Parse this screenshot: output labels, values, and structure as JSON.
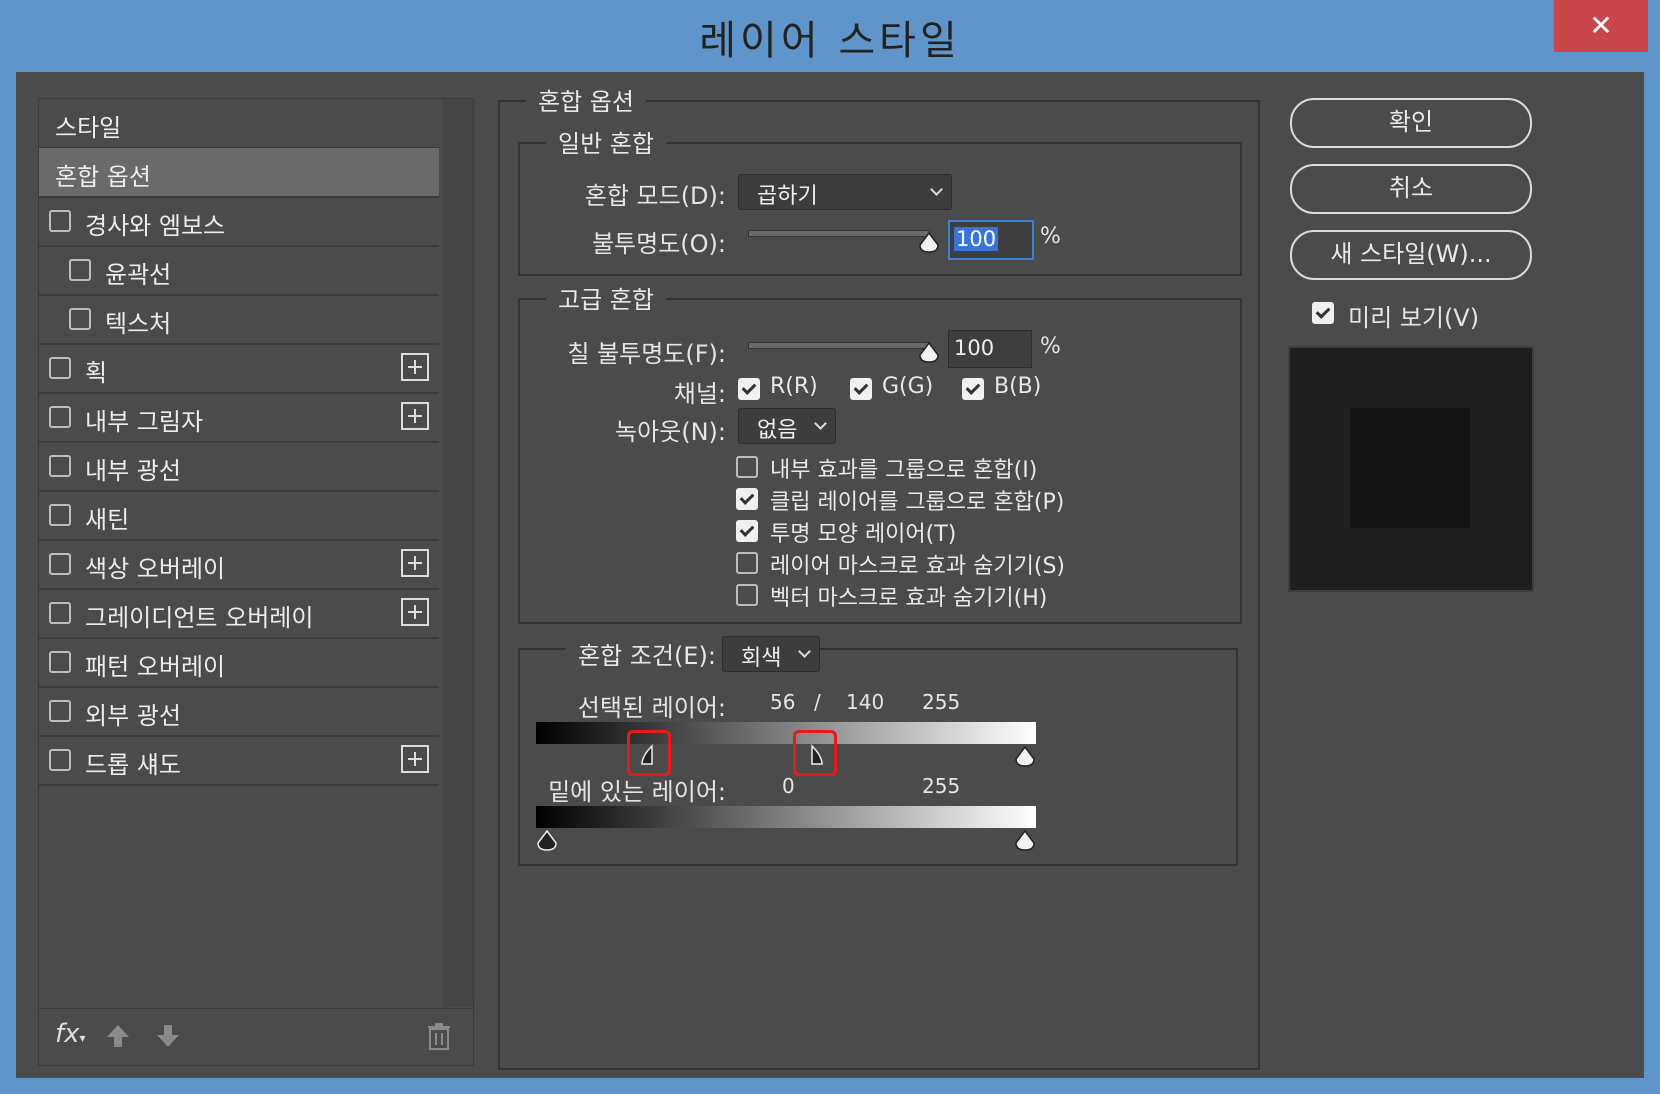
{
  "window": {
    "title": "레이어 스타일",
    "close_glyph": "✕"
  },
  "styles_panel": {
    "items": [
      {
        "label": "스타일",
        "checkbox": false,
        "checked": false,
        "plus": false,
        "selected": false
      },
      {
        "label": "혼합 옵션",
        "checkbox": false,
        "checked": false,
        "plus": false,
        "selected": true
      },
      {
        "label": "경사와 엠보스",
        "checkbox": true,
        "checked": false,
        "plus": false,
        "selected": false
      },
      {
        "label": "윤곽선",
        "checkbox": true,
        "checked": false,
        "plus": false,
        "selected": false
      },
      {
        "label": "텍스처",
        "checkbox": true,
        "checked": false,
        "plus": false,
        "selected": false
      },
      {
        "label": "획",
        "checkbox": true,
        "checked": false,
        "plus": true,
        "selected": false
      },
      {
        "label": "내부 그림자",
        "checkbox": true,
        "checked": false,
        "plus": true,
        "selected": false
      },
      {
        "label": "내부 광선",
        "checkbox": true,
        "checked": false,
        "plus": false,
        "selected": false
      },
      {
        "label": "새틴",
        "checkbox": true,
        "checked": false,
        "plus": false,
        "selected": false
      },
      {
        "label": "색상 오버레이",
        "checkbox": true,
        "checked": false,
        "plus": true,
        "selected": false
      },
      {
        "label": "그레이디언트 오버레이",
        "checkbox": true,
        "checked": false,
        "plus": true,
        "selected": false
      },
      {
        "label": "패턴 오버레이",
        "checkbox": true,
        "checked": false,
        "plus": false,
        "selected": false
      },
      {
        "label": "외부 광선",
        "checkbox": true,
        "checked": false,
        "plus": false,
        "selected": false
      },
      {
        "label": "드롭 섀도",
        "checkbox": true,
        "checked": false,
        "plus": true,
        "selected": false
      }
    ],
    "footer": {
      "fx_label": "fx",
      "icons": [
        "fx-menu-icon",
        "move-up-icon",
        "move-down-icon",
        "trash-icon"
      ]
    }
  },
  "blending": {
    "section_title": "혼합 옵션",
    "general": {
      "title": "일반 혼합",
      "mode_label": "혼합 모드(D):",
      "mode_value": "곱하기",
      "opacity_label": "불투명도(O):",
      "opacity_value": "100",
      "unit": "%"
    },
    "advanced": {
      "title": "고급 혼합",
      "fill_label": "칠 불투명도(F):",
      "fill_value": "100",
      "unit": "%",
      "channels_label": "채널:",
      "channels": [
        {
          "label": "R(R)",
          "checked": true
        },
        {
          "label": "G(G)",
          "checked": true
        },
        {
          "label": "B(B)",
          "checked": true
        }
      ],
      "knockout_label": "녹아웃(N):",
      "knockout_value": "없음",
      "options": [
        {
          "label": "내부 효과를 그룹으로 혼합(I)",
          "checked": false
        },
        {
          "label": "클립 레이어를 그룹으로 혼합(P)",
          "checked": true
        },
        {
          "label": "투명 모양 레이어(T)",
          "checked": true
        },
        {
          "label": "레이어 마스크로 효과 숨기기(S)",
          "checked": false
        },
        {
          "label": "벡터 마스크로 효과 숨기기(H)",
          "checked": false
        }
      ]
    },
    "blend_if": {
      "label": "혼합 조건(E):",
      "value": "회색",
      "this_layer": {
        "label": "선택된 레이어:",
        "low": "56",
        "sep": "/",
        "mid": "140",
        "high": "255"
      },
      "underlying": {
        "label": "밑에 있는 레이어:",
        "low": "0",
        "high": "255"
      }
    }
  },
  "buttons": {
    "ok": "확인",
    "cancel": "취소",
    "new_style": "새 스타일(W)..."
  },
  "preview": {
    "label": "미리 보기(V)",
    "checked": true
  }
}
